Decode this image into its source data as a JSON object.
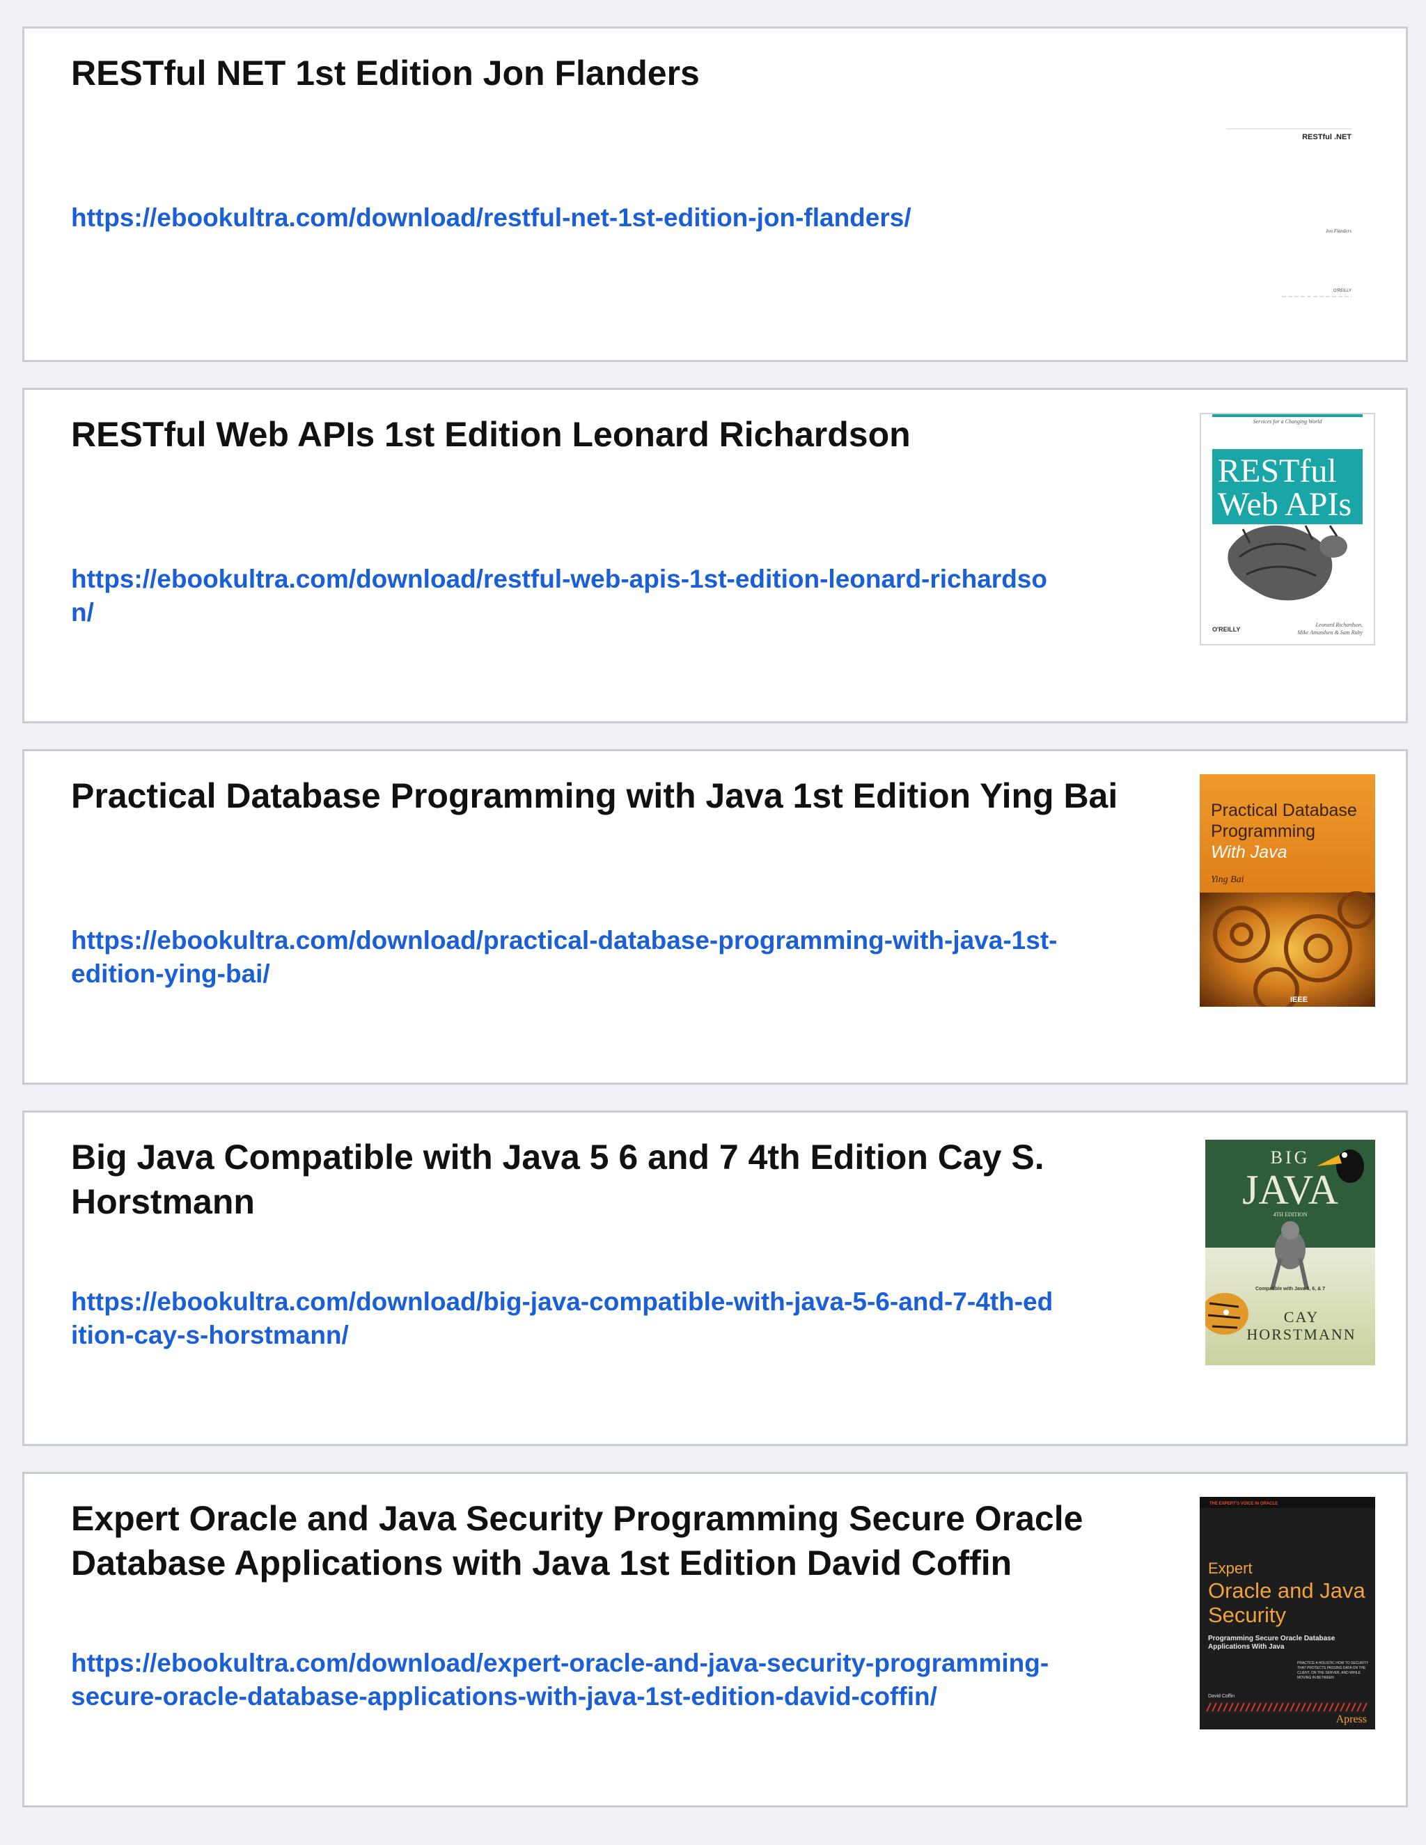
{
  "books": [
    {
      "title": "RESTful NET 1st Edition Jon Flanders",
      "link": "https://ebookultra.com/download/restful-net-1st-edition-jon-flanders/",
      "cover": {
        "title": "RESTful .NET",
        "author": "Jon Flanders",
        "publisher": "O'REILLY"
      }
    },
    {
      "title": "RESTful Web APIs 1st Edition Leonard Richardson",
      "link": "https://ebookultra.com/download/restful-web-apis-1st-edition-leonard-richardson/",
      "cover": {
        "tagline": "Services for a Changing World",
        "title_line1": "RESTful",
        "title_line2": "Web APIs",
        "authors_line1": "Leonard Richardson,",
        "authors_line2": "Mike Amundsen & Sam Ruby",
        "publisher": "O'REILLY",
        "accent": "#1aa6a6"
      }
    },
    {
      "title": "Practical Database Programming with Java 1st Edition Ying Bai",
      "link": "https://ebookultra.com/download/practical-database-programming-with-java-1st-edition-ying-bai/",
      "cover": {
        "title_line1": "Practical Database",
        "title_line2": "Programming",
        "title_line3": "With Java",
        "author": "Ying Bai",
        "publisher": "IEEE",
        "accent": "#e58a1f"
      }
    },
    {
      "title": "Big Java Compatible with Java 5 6 and 7 4th Edition Cay S. Horstmann",
      "link": "https://ebookultra.com/download/big-java-compatible-with-java-5-6-and-7-4th-edition-cay-s-horstmann/",
      "cover": {
        "title_line1": "BIG",
        "title_line2": "JAVA",
        "edition": "4TH EDITION",
        "compat": "Compatible with Java 5, 6, & 7",
        "author_line1": "CAY",
        "author_line2": "HORSTMANN",
        "accent": "#2f5d3a"
      }
    },
    {
      "title": "Expert Oracle and Java Security Programming Secure Oracle Database Applications with Java 1st Edition David Coffin",
      "link": "https://ebookultra.com/download/expert-oracle-and-java-security-programming-secure-oracle-database-applications-with-java-1st-edition-david-coffin/",
      "cover": {
        "banner": "THE EXPERT'S VOICE IN ORACLE",
        "title_line1": "Expert",
        "title_line2": "Oracle and Java",
        "title_line3": "Security",
        "subtitle_line1": "Programming Secure Oracle Database",
        "subtitle_line2": "Applications With Java",
        "blurb_line1": "PRACTICE A HOLISTIC HOW TO SECURITY",
        "blurb_line2": "THAT PROTECTS PASSING DATA ON THE",
        "blurb_line3": "CLIENT, ON THE SERVER, AND WHILE",
        "blurb_line4": "MOVING IN BETWEEN",
        "author": "David Coffin",
        "publisher": "Apress",
        "accent": "#f2a23a"
      }
    }
  ]
}
